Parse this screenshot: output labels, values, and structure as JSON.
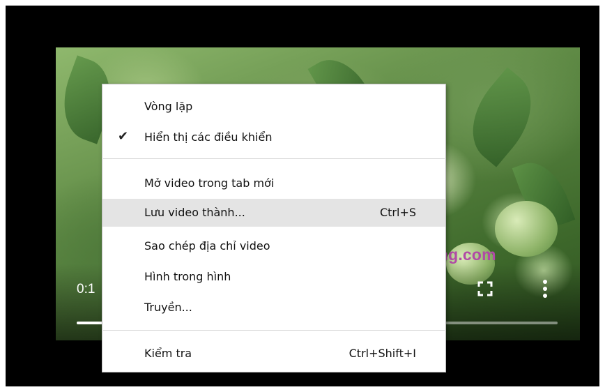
{
  "player": {
    "time_display": "0:1",
    "progress_fraction": 0.08,
    "watermark": "Quantrimang.com"
  },
  "context_menu": {
    "items": [
      {
        "label": "Vòng lặp",
        "shortcut": "",
        "checked": false
      },
      {
        "label": "Hiển thị các điều khiển",
        "shortcut": "",
        "checked": true
      },
      {
        "label": "Mở video trong tab mới",
        "shortcut": "",
        "checked": false
      },
      {
        "label": "Lưu video thành...",
        "shortcut": "Ctrl+S",
        "checked": false,
        "highlighted": true
      },
      {
        "label": "Sao chép địa chỉ video",
        "shortcut": "",
        "checked": false
      },
      {
        "label": "Hình trong hình",
        "shortcut": "",
        "checked": false
      },
      {
        "label": "Truyền...",
        "shortcut": "",
        "checked": false
      },
      {
        "label": "Kiểm tra",
        "shortcut": "Ctrl+Shift+I",
        "checked": false
      }
    ],
    "check_glyph": "✔"
  },
  "icons": {
    "fullscreen": "fullscreen-icon",
    "more": "more-vert-icon",
    "check": "checkmark-icon"
  },
  "colors": {
    "watermark": "#b14aa6",
    "highlight": "#e4e4e4"
  }
}
